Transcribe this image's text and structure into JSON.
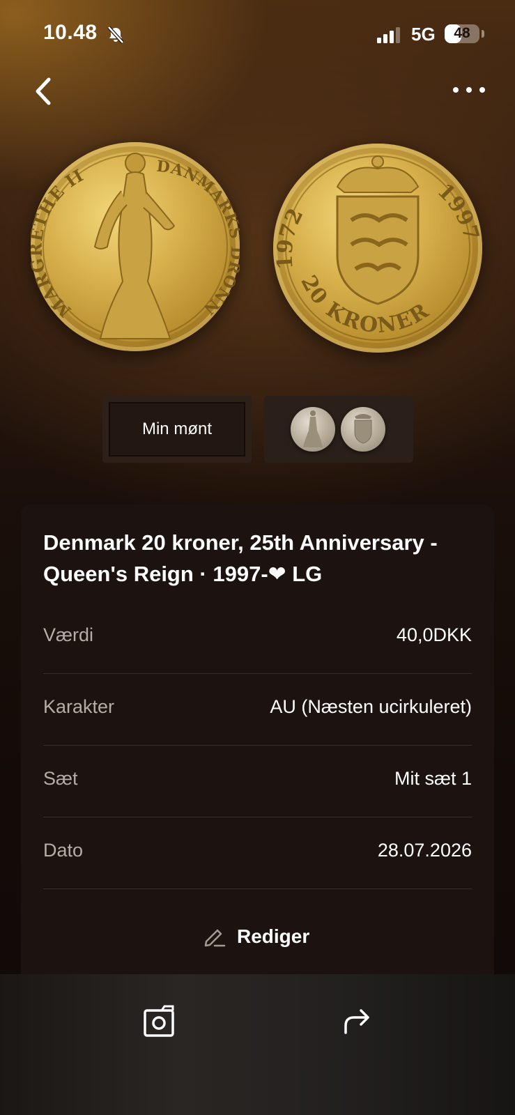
{
  "status_bar": {
    "time": "10.48",
    "network": "5G",
    "battery": "48",
    "battery_level": 0.48
  },
  "nav": {
    "back_icon": "chevron-left-icon",
    "more_icon": "more-horizontal-icon"
  },
  "coin_images": {
    "front_inscription_left": "MARGRETHE II",
    "front_inscription_right": "DANMARKS DRONNING",
    "back_year_left": "1972",
    "back_year_right": "1997",
    "back_denomination": "20 KRONER"
  },
  "image_tabs": {
    "my_coin_label": "Min mønt"
  },
  "detail": {
    "title": "Denmark 20 kroner, 25th Anniversary - Queen's Reign · 1997-❤ LG",
    "rows": [
      {
        "label": "Værdi",
        "value": "40,0DKK"
      },
      {
        "label": "Karakter",
        "value": "AU (Næsten ucirkuleret)"
      },
      {
        "label": "Sæt",
        "value": "Mit sæt 1"
      },
      {
        "label": "Dato",
        "value": "28.07.2026"
      }
    ],
    "edit_label": "Rediger"
  },
  "bottom_bar": {
    "camera_icon": "camera-icon",
    "share_icon": "share-icon"
  },
  "colors": {
    "gold": "#d9b24e",
    "card_bg": "#1c1310",
    "label_gray": "#b7aca6"
  }
}
